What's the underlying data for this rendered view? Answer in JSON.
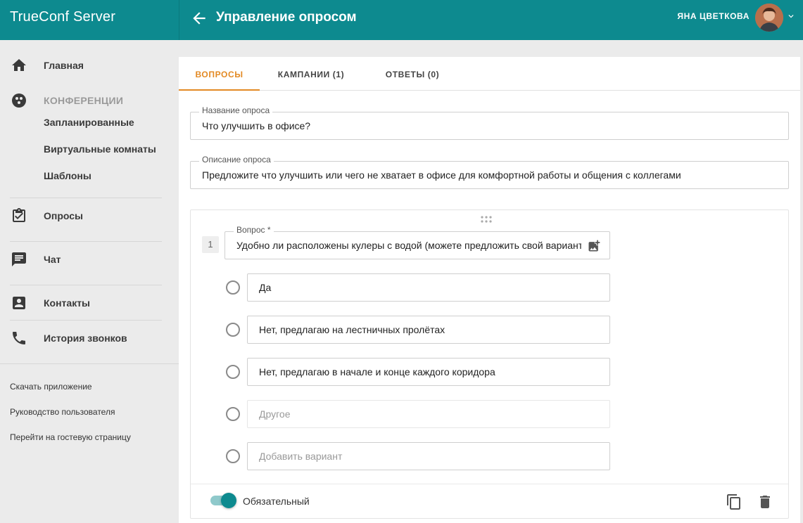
{
  "app": {
    "title": "TrueConf Server"
  },
  "header": {
    "page_title": "Управление опросом",
    "user_name": "ЯНА ЦВЕТКОВА"
  },
  "sidebar": {
    "home": "Главная",
    "conferences": "КОНФЕРЕНЦИИ",
    "scheduled": "Запланированные",
    "virtual_rooms": "Виртуальные комнаты",
    "templates": "Шаблоны",
    "surveys": "Опросы",
    "chat": "Чат",
    "contacts": "Контакты",
    "call_history": "История звонков",
    "download_app": "Скачать приложение",
    "user_guide": "Руководство пользователя",
    "guest_page": "Перейти на гостевую страницу"
  },
  "tabs": [
    {
      "label": "ВОПРОСЫ",
      "active": true
    },
    {
      "label": "КАМПАНИИ (1)",
      "active": false
    },
    {
      "label": "ОТВЕТЫ (0)",
      "active": false
    }
  ],
  "survey": {
    "name_label": "Название опроса",
    "name_value": "Что улучшить в офисе?",
    "desc_label": "Описание опроса",
    "desc_value": "Предложите что улучшить или чего не хватает в офисе для комфортной работы и общения с коллегами"
  },
  "question": {
    "number": "1",
    "label": "Вопрос *",
    "value": "Удобно ли расположены кулеры с водой (можете предложить свой вариант)?",
    "options": [
      {
        "text": "Да"
      },
      {
        "text": "Нет, предлагаю на лестничных пролётах"
      },
      {
        "text": "Нет, предлагаю в начале и конце каждого коридора"
      }
    ],
    "other_placeholder": "Другое",
    "add_placeholder": "Добавить вариант",
    "required_label": "Обязательный",
    "required": true
  },
  "colors": {
    "header": "#0d8a8f",
    "accent": "#e38a24"
  },
  "icons": {
    "home": "home-icon",
    "conferences": "conference-icon",
    "surveys": "clipboard-check-icon",
    "chat": "chat-icon",
    "contacts": "contact-card-icon",
    "call_history": "phone-icon",
    "back": "arrow-left-icon",
    "add_image": "add-image-icon",
    "copy": "copy-icon",
    "delete": "trash-icon",
    "drag": "drag-handle-icon"
  }
}
